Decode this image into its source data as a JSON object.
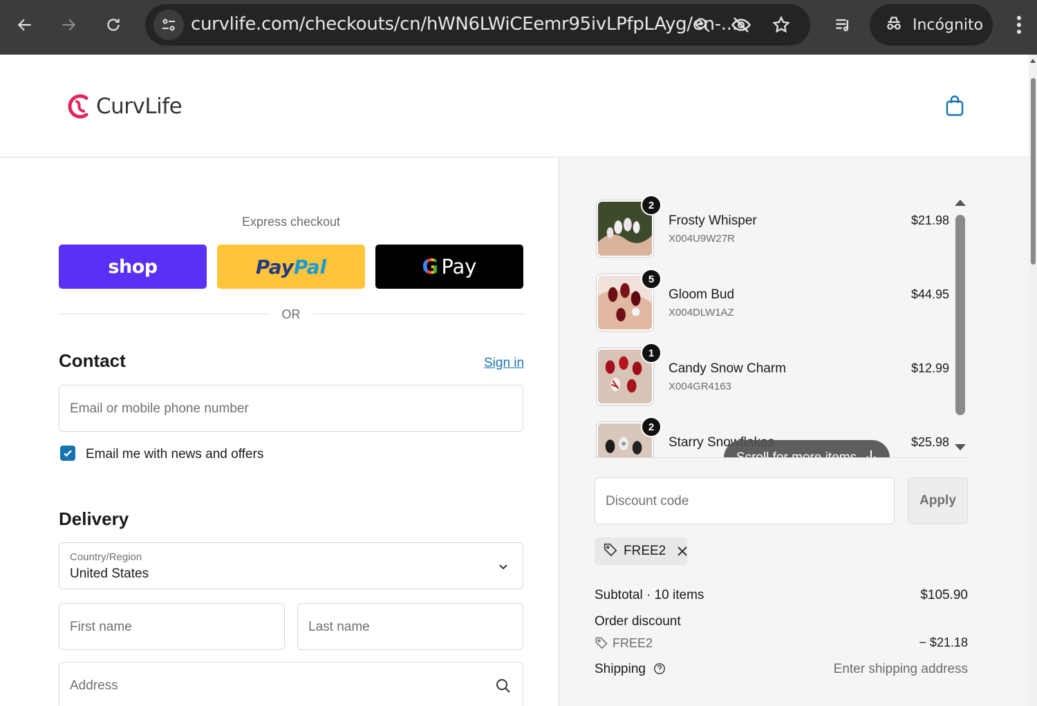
{
  "browser": {
    "url": "curvlife.com/checkouts/cn/hWN6LWiCEemr95ivLPfpLAyg/en-...",
    "profile_label": "Incógnito",
    "icons": [
      "back-icon",
      "forward-icon",
      "reload-icon",
      "site-info-icon",
      "zoom-icon",
      "tracking-protection-icon",
      "bookmark-star-icon",
      "media-controls-icon",
      "incognito-icon",
      "menu-icon"
    ]
  },
  "header": {
    "logo_text": "CurvLife",
    "brand_color": "#e0245e",
    "cart_icon": "shopping-bag-icon"
  },
  "express": {
    "label": "Express checkout",
    "shop_label": "shop",
    "paypal_part1": "Pay",
    "paypal_part2": "Pal",
    "gpay_label": "Pay",
    "gpay_letter": "G",
    "or_label": "OR"
  },
  "contact": {
    "title": "Contact",
    "signin_label": "Sign in",
    "email_placeholder": "Email or mobile phone number",
    "newsletter_label": "Email me with news and offers",
    "newsletter_checked": true
  },
  "delivery": {
    "title": "Delivery",
    "country_label": "Country/Region",
    "country_value": "United States",
    "first_name_placeholder": "First name",
    "last_name_placeholder": "Last name",
    "address_placeholder": "Address"
  },
  "order": {
    "items": [
      {
        "name": "Frosty Whisper",
        "sku": "X004U9W27R",
        "price": "$21.98",
        "qty": "2"
      },
      {
        "name": "Gloom Bud",
        "sku": "X004DLW1AZ",
        "price": "$44.95",
        "qty": "5"
      },
      {
        "name": "Candy Snow Charm",
        "sku": "X004GR4163",
        "price": "$12.99",
        "qty": "1"
      },
      {
        "name": "Starry Snowflakes",
        "sku": "",
        "price": "$25.98",
        "qty": "2"
      }
    ],
    "scroll_hint": "Scroll for more items",
    "discount_placeholder": "Discount code",
    "apply_label": "Apply",
    "applied_code": "FREE2",
    "subtotal_label": "Subtotal · 10 items",
    "subtotal_value": "$105.90",
    "order_discount_label": "Order discount",
    "discount_code": "FREE2",
    "discount_value": "− $21.18",
    "shipping_label": "Shipping",
    "shipping_value": "Enter shipping address",
    "accent_color": "#1773b0"
  }
}
